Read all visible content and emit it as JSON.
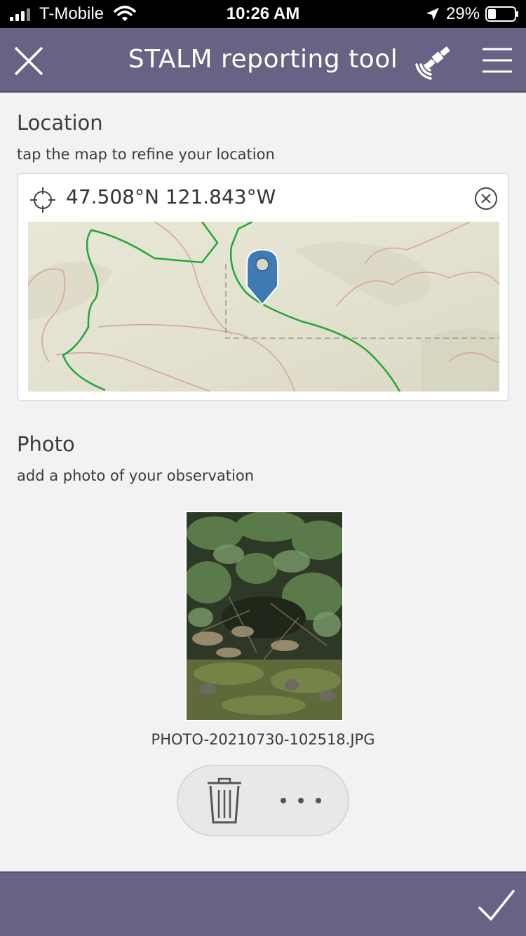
{
  "status_bar": {
    "carrier": "T-Mobile",
    "time": "10:26 AM",
    "battery_percent": "29%",
    "icons": [
      "signal-bars-icon",
      "wifi-icon",
      "location-arrow-icon",
      "battery-icon"
    ]
  },
  "header": {
    "title": "STALM reporting tool",
    "icons": [
      "close-icon",
      "satellite-icon",
      "hamburger-menu-icon"
    ]
  },
  "location": {
    "title": "Location",
    "hint": "tap the map to refine your location",
    "coordinates": "47.508°N 121.843°W",
    "icons": [
      "crosshair-icon",
      "clear-circle-icon",
      "map-pin-icon"
    ]
  },
  "photo": {
    "title": "Photo",
    "hint": "add a photo of your observation",
    "filename": "PHOTO-20210730-102518.JPG",
    "icons": [
      "trash-icon",
      "more-dots-icon"
    ]
  },
  "footer": {
    "icons": [
      "checkmark-icon"
    ]
  },
  "colors": {
    "nav_bar": "#6a6285",
    "map_pin": "#3f7ab5",
    "trail": "#1fa83a",
    "contour": "#d4a89a"
  }
}
